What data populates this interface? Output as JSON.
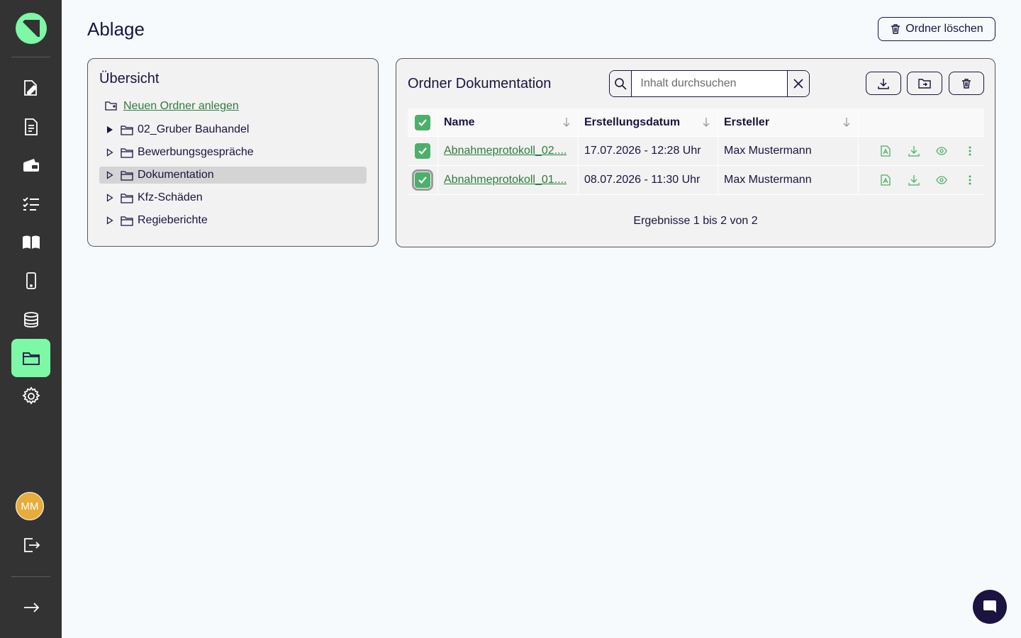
{
  "page": {
    "title": "Ablage",
    "delete_folder_label": "Ordner löschen"
  },
  "sidebar": {
    "items": [
      {
        "icon": "edit-document-icon",
        "active": false
      },
      {
        "icon": "document-icon",
        "active": false
      },
      {
        "icon": "wallet-icon",
        "active": false
      },
      {
        "icon": "checklist-icon",
        "active": false
      },
      {
        "icon": "book-icon",
        "active": false
      },
      {
        "icon": "mobile-icon",
        "active": false
      },
      {
        "icon": "database-icon",
        "active": false
      },
      {
        "icon": "folder-icon",
        "active": true
      },
      {
        "icon": "gear-icon",
        "active": false
      }
    ],
    "avatar_initials": "MM",
    "logout_icon": "logout-icon",
    "expand_icon": "arrow-right-icon"
  },
  "overview": {
    "title": "Übersicht",
    "new_folder_label": "Neuen Ordner anlegen",
    "tree": [
      {
        "label": "02_Gruber Bauhandel",
        "expanded": true,
        "selected": false
      },
      {
        "label": "Bewerbungsgespräche",
        "expanded": false,
        "selected": false
      },
      {
        "label": "Dokumentation",
        "expanded": false,
        "selected": true
      },
      {
        "label": "Kfz-Schäden",
        "expanded": false,
        "selected": false
      },
      {
        "label": "Regieberichte",
        "expanded": false,
        "selected": false
      }
    ]
  },
  "folder": {
    "title": "Ordner Dokumentation",
    "search_placeholder": "Inhalt durchsuchen",
    "search_value": "",
    "columns": [
      "Name",
      "Erstellungsdatum",
      "Ersteller"
    ],
    "rows": [
      {
        "name": "Abnahmeprotokoll_02....",
        "date": "17.07.2026 - 12:28 Uhr",
        "creator": "Max Mustermann",
        "checked": true
      },
      {
        "name": "Abnahmeprotokoll_01....",
        "date": "08.07.2026 - 11:30 Uhr",
        "creator": "Max Mustermann",
        "checked": true
      }
    ],
    "results_text": "Ergebnisse 1 bis 2 von 2"
  },
  "colors": {
    "accent": "#7df8a6",
    "sidebar": "#333333",
    "primary": "#1b1340",
    "link": "#2e7d3b",
    "checkbox": "#4caf6a",
    "avatar": "#e6ac3c"
  }
}
